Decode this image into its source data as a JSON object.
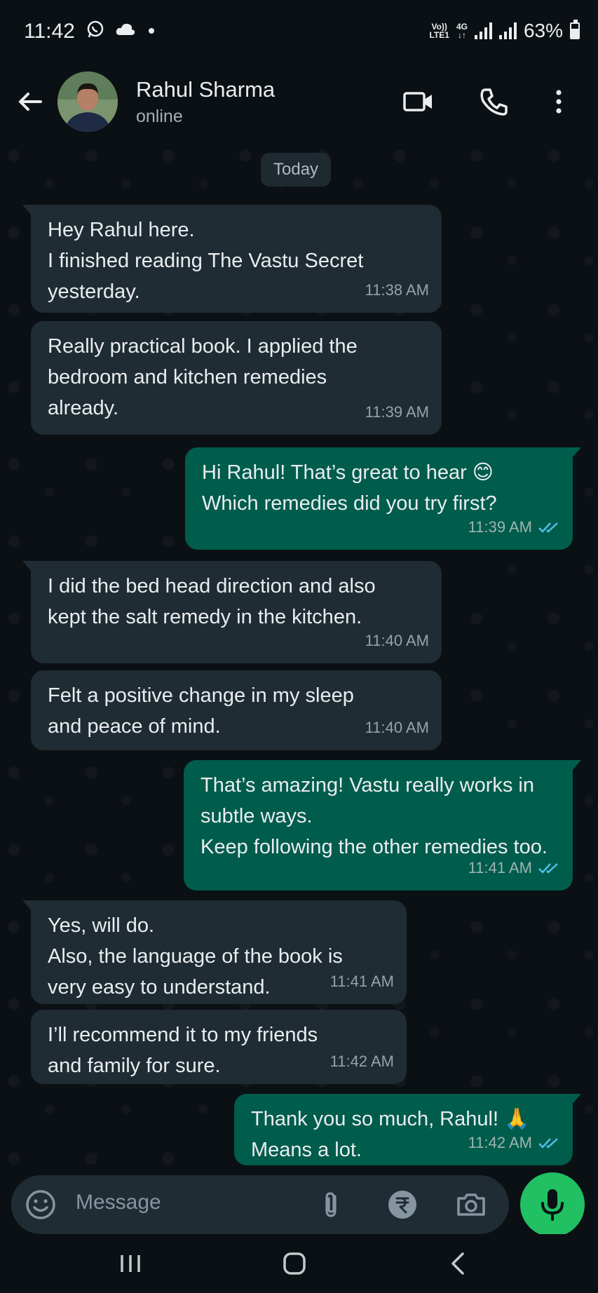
{
  "status_bar": {
    "time": "11:42",
    "network_top": "Vo))",
    "network_bottom": "LTE1",
    "network_type": "4G",
    "battery": "63%",
    "battery_level": 0.63,
    "icons": [
      "whatsapp-icon",
      "cloud-icon",
      "dot-icon",
      "signal-icon",
      "battery-icon"
    ]
  },
  "header": {
    "contact_name": "Rahul Sharma",
    "status": "online",
    "icons": [
      "back-arrow-icon",
      "video-call-icon",
      "voice-call-icon",
      "more-vert-icon"
    ]
  },
  "chat": {
    "date_chip": "Today",
    "messages": [
      {
        "direction": "in",
        "text": "Hey Rahul here.\nI finished reading The Vastu Secret\nyesterday.",
        "time": "11:38 AM"
      },
      {
        "direction": "in",
        "text": "Really practical book. I applied the\nbedroom and kitchen remedies\nalready.",
        "time": "11:39 AM"
      },
      {
        "direction": "out",
        "text": "Hi Rahul! That’s great to hear 😊\nWhich remedies did you try first?",
        "time": "11:39 AM",
        "read": true
      },
      {
        "direction": "in",
        "text": "I did the bed head direction and also\nkept the salt remedy in the kitchen.",
        "time": "11:40 AM"
      },
      {
        "direction": "in",
        "text": "Felt a positive change in my sleep\nand peace of mind.",
        "time": "11:40 AM"
      },
      {
        "direction": "out",
        "text": "That’s amazing! Vastu really works in\nsubtle ways.\nKeep following the other remedies too.",
        "time": "11:41 AM",
        "read": true
      },
      {
        "direction": "in",
        "text": "Yes, will do.\nAlso, the language of the book is\nvery easy to understand.",
        "time": "11:41 AM"
      },
      {
        "direction": "in",
        "text": "I’ll recommend it to my friends\nand family for sure.",
        "time": "11:42 AM"
      },
      {
        "direction": "out",
        "text": "Thank you so much, Rahul! 🙏\nMeans a lot.",
        "time": "11:42 AM",
        "read": true
      }
    ]
  },
  "input_bar": {
    "placeholder": "Message",
    "icons": [
      "emoji-icon",
      "attach-icon",
      "rupee-payment-icon",
      "camera-icon",
      "mic-icon"
    ]
  },
  "nav_bar": {
    "icons": [
      "recent-apps-icon",
      "home-icon",
      "back-icon"
    ]
  },
  "colors": {
    "background": "#0b1014",
    "incoming_bubble": "#1f2c33",
    "outgoing_bubble": "#005c4b",
    "accent_green": "#21c063",
    "read_ticks": "#53bdeb"
  }
}
